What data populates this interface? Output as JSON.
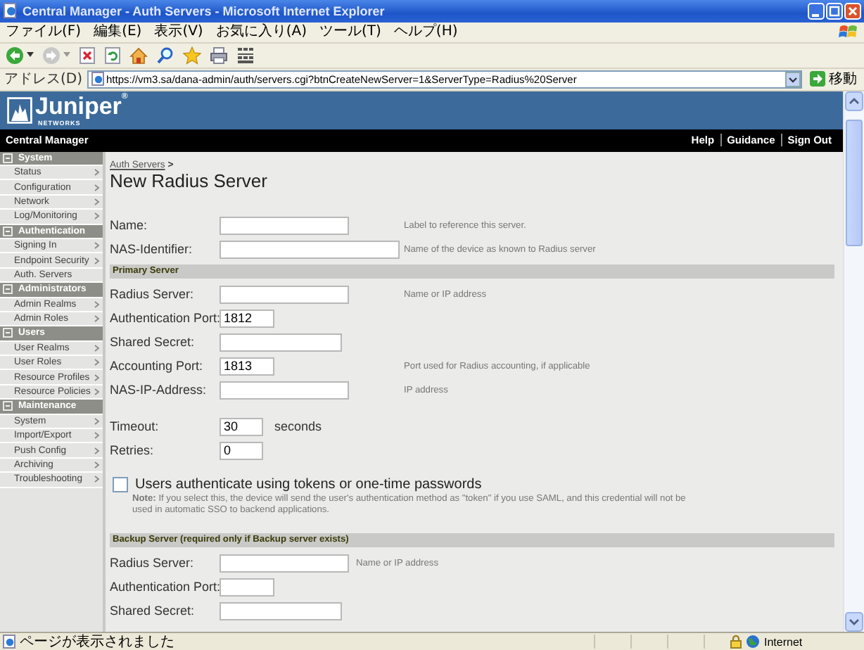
{
  "window": {
    "title": "Central Manager - Auth Servers - Microsoft Internet Explorer"
  },
  "menu": [
    {
      "label": "ファイル(F)"
    },
    {
      "label": "編集(E)"
    },
    {
      "label": "表示(V)"
    },
    {
      "label": "お気に入り(A)"
    },
    {
      "label": "ツール(T)"
    },
    {
      "label": "ヘルプ(H)"
    }
  ],
  "address": {
    "label": "アドレス(D)",
    "value": "https://vm3.sa/dana-admin/auth/servers.cgi?btnCreateNewServer=1&ServerType=Radius%20Server",
    "go": "移動"
  },
  "header": {
    "logo": "Juniper$^{®}$",
    "logo_sub": "NETWORKS"
  },
  "navbar": {
    "title": "Central Manager",
    "links": [
      "Help",
      "Guidance",
      "Sign Out"
    ]
  },
  "sidebar": [
    {
      "title": "System",
      "expanded": true,
      "items": [
        {
          "label": "Status",
          "has_submenu": true
        },
        {
          "label": "Configuration",
          "has_submenu": true
        },
        {
          "label": "Network",
          "has_submenu": true
        },
        {
          "label": "Log/Monitoring",
          "has_submenu": true
        }
      ]
    },
    {
      "title": "Authentication",
      "expanded": true,
      "items": [
        {
          "label": "Signing In",
          "has_submenu": true
        },
        {
          "label": "Endpoint Security",
          "has_submenu": true
        },
        {
          "label": "Auth. Servers",
          "has_submenu": false
        }
      ]
    },
    {
      "title": "Administrators",
      "expanded": true,
      "items": [
        {
          "label": "Admin Realms",
          "has_submenu": true
        },
        {
          "label": "Admin Roles",
          "has_submenu": true
        }
      ]
    },
    {
      "title": "Users",
      "expanded": true,
      "items": [
        {
          "label": "User Realms",
          "has_submenu": true
        },
        {
          "label": "User Roles",
          "has_submenu": true
        },
        {
          "label": "Resource Profiles",
          "has_submenu": true
        },
        {
          "label": "Resource Policies",
          "has_submenu": true
        }
      ]
    },
    {
      "title": "Maintenance",
      "expanded": true,
      "items": [
        {
          "label": "System",
          "has_submenu": true
        },
        {
          "label": "Import/Export",
          "has_submenu": true
        },
        {
          "label": "Push Config",
          "has_submenu": true
        },
        {
          "label": "Archiving",
          "has_submenu": true
        },
        {
          "label": "Troubleshooting",
          "has_submenu": true
        }
      ]
    }
  ],
  "breadcrumb": {
    "link": "Auth Servers",
    "separator": ">"
  },
  "page_title": "New Radius Server",
  "general": [
    {
      "label": "Name:",
      "kind": "name",
      "hint": "Label to reference this server."
    },
    {
      "label": "NAS-Identifier:",
      "kind": "wide",
      "hint": "Name of the device as known to Radius server"
    }
  ],
  "primary_server": {
    "title": "Primary Server",
    "rows": [
      {
        "label": "Radius Server:",
        "kind": "name",
        "hint": "Name or IP address"
      },
      {
        "label": "Authentication Port:",
        "kind": "port",
        "value": "1812"
      },
      {
        "label": "Shared Secret:",
        "kind": "secret"
      },
      {
        "label": "Accounting Port:",
        "kind": "port",
        "value": "1813",
        "hint": "Port used for Radius accounting, if applicable"
      },
      {
        "label": "NAS-IP-Address:",
        "kind": "name",
        "hint": "IP address"
      }
    ]
  },
  "timing": [
    {
      "label": "Timeout:",
      "kind": "short",
      "value": "30",
      "unit": "seconds"
    },
    {
      "label": "Retries:",
      "kind": "short",
      "value": "0"
    }
  ],
  "token_option": {
    "label": "Users authenticate using tokens or one-time passwords",
    "checked": false,
    "note": "**Note:** If you select this, the device will send the user's authentication method as \"token\" if you use SAML, and this credential will not be used in automatic SSO to backend applications."
  },
  "backup_server": {
    "title": "Backup Server (required only if Backup server exists)",
    "rows": [
      {
        "label": "Radius Server:",
        "kind": "name",
        "hint": "Name or IP address"
      },
      {
        "label": "Authentication Port:",
        "kind": "port"
      },
      {
        "label": "Shared Secret:",
        "kind": "secret"
      }
    ]
  },
  "status_bar": {
    "text": "ページが表示されました",
    "zone": "Internet"
  }
}
